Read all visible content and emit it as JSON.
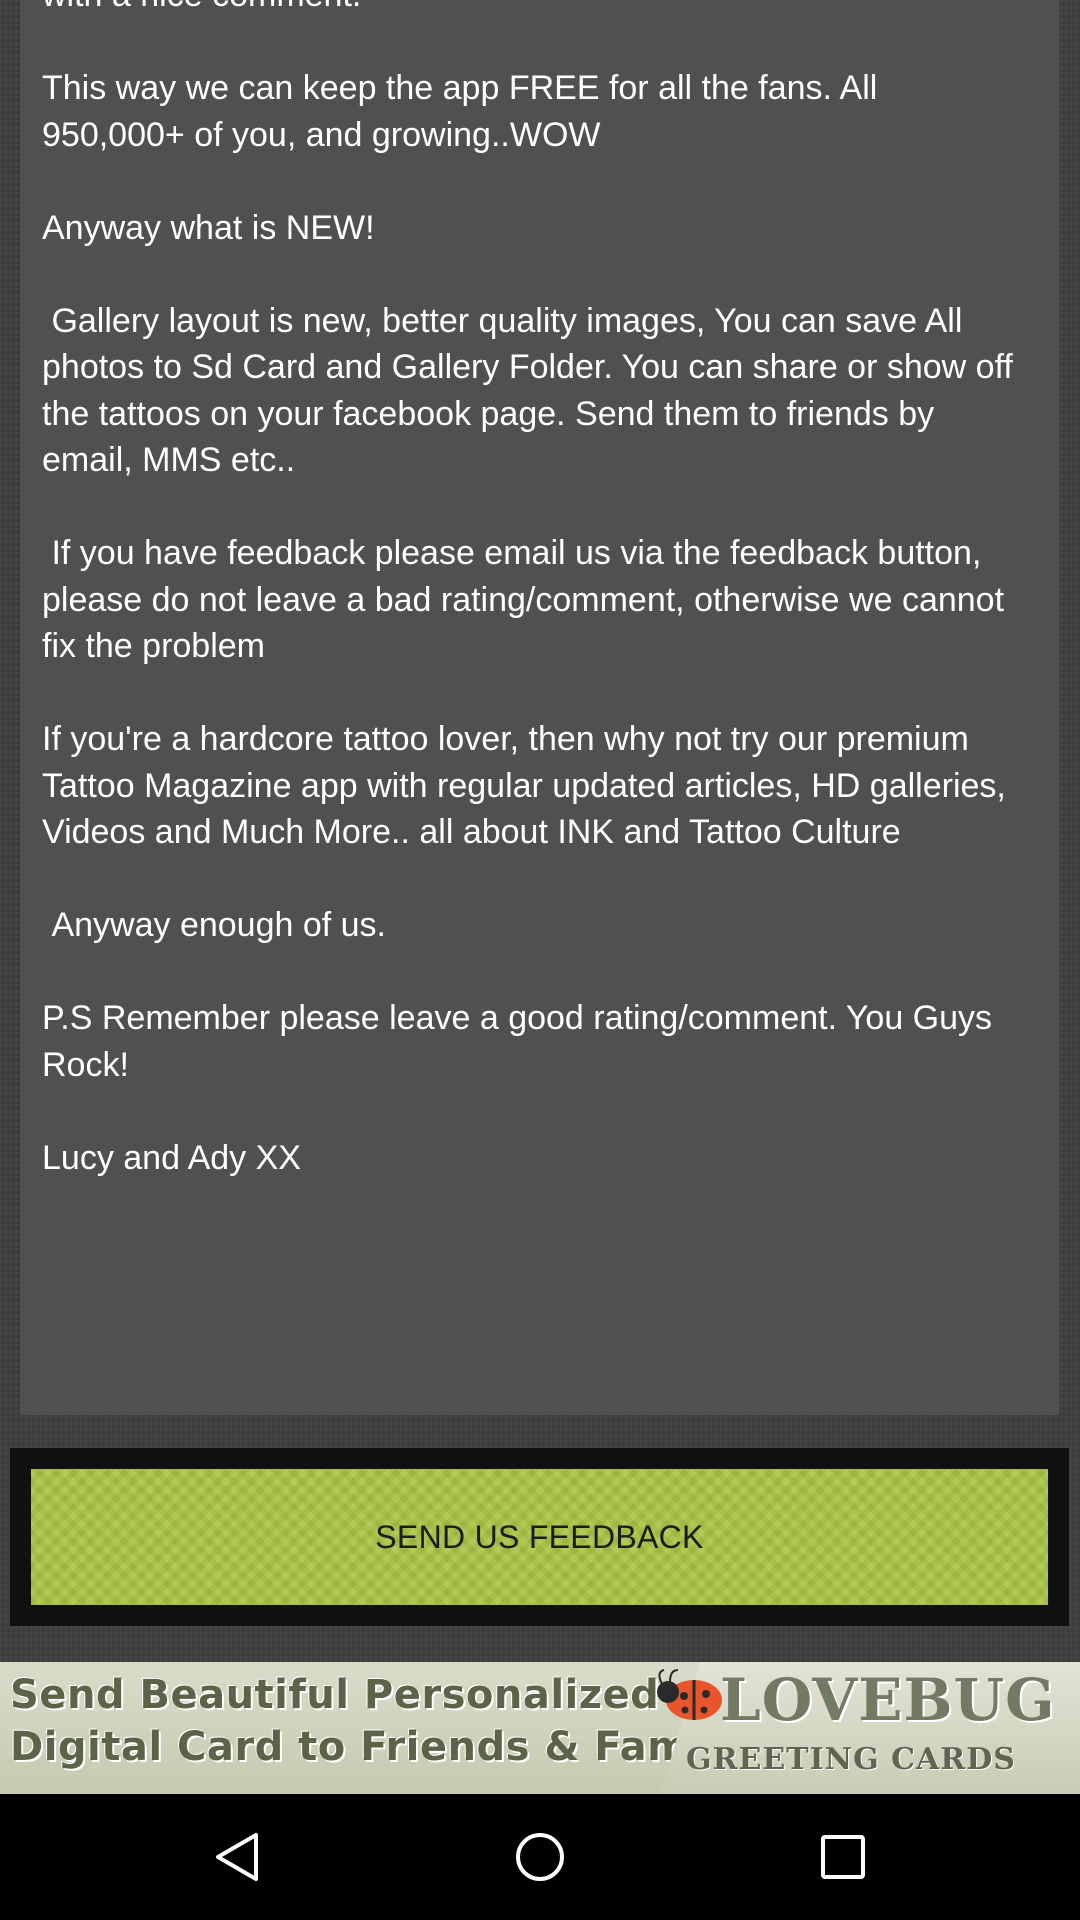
{
  "description": {
    "text": "with a nice comment.\n\nThis way we can keep the app FREE for all the fans. All 950,000+ of you, and growing..WOW\n\nAnyway what is NEW!\n\n Gallery layout is new, better quality images, You can save All photos to Sd Card and Gallery Folder. You can share or show off the tattoos on your facebook page. Send them to friends by email, MMS etc..\n\n If you have feedback please email us via the feedback button, please do not leave a bad rating/comment, otherwise we cannot fix the problem\n\nIf you're a hardcore tattoo lover, then why not try our premium Tattoo Magazine app with regular updated articles, HD galleries, Videos and Much More.. all about INK and Tattoo Culture\n\n Anyway enough of us.\n\nP.S Remember please leave a good rating/comment. You Guys Rock!\n\nLucy and Ady XX"
  },
  "feedback": {
    "button_label": "SEND US FEEDBACK"
  },
  "ad": {
    "line1": "Send  Beautiful Personalized",
    "line2": "Digital Card to Friends & Family",
    "brand_top": "LOVEBUG",
    "brand_bottom": "GREETING CARDS",
    "icon": "ladybug-icon"
  },
  "navigation": {
    "back_icon": "back-triangle-icon",
    "home_icon": "home-circle-icon",
    "recent_icon": "recent-apps-square-icon"
  },
  "colors": {
    "panel": "#505050",
    "background": "#3f3f3f",
    "button": "#a9c445",
    "nav_bar": "#000000"
  }
}
